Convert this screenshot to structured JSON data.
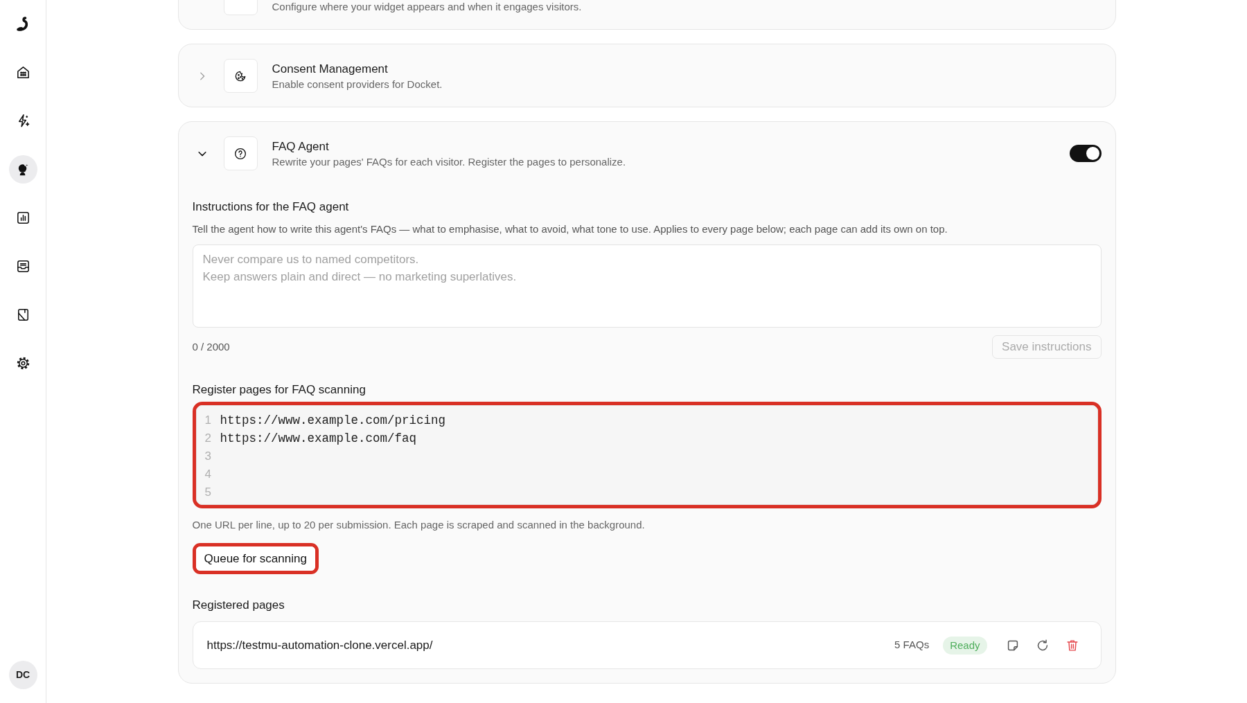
{
  "sidebar": {
    "items": [
      {
        "selected": false
      },
      {
        "selected": false
      },
      {
        "selected": true
      },
      {
        "selected": false
      },
      {
        "selected": false
      },
      {
        "selected": false
      },
      {
        "selected": false
      }
    ],
    "avatar": "DC"
  },
  "sections": [
    {
      "description": "Configure where your widget appears and when it engages visitors."
    },
    {
      "title": "Consent Management",
      "description": "Enable consent providers for Docket.",
      "expanded": false
    },
    {
      "title": "FAQ Agent",
      "description": "Rewrite your pages' FAQs for each visitor. Register the pages to personalize.",
      "expanded": true,
      "enabled": true,
      "instructions": {
        "heading": "Instructions for the FAQ agent",
        "hint": "Tell the agent how to write this agent's FAQs — what to emphasise, what to avoid, what tone to use. Applies to every page below; each page can add its own on top.",
        "placeholder": "Never compare us to named competitors.\nKeep answers plain and direct — no marketing superlatives.",
        "counter": "0 / 2000",
        "save_button": {
          "label": "Save instructions",
          "disabled": true
        }
      },
      "register": {
        "heading": "Register pages for FAQ scanning",
        "highlighted": true,
        "lines": [
          {
            "number": "1",
            "text": "https://www.example.com/pricing"
          },
          {
            "number": "2",
            "text": "https://www.example.com/faq"
          },
          {
            "number": "3"
          },
          {
            "number": "4"
          },
          {
            "number": "5"
          }
        ],
        "hint": "One URL per line, up to 20 per submission. Each page is scraped and scanned in the background.",
        "queue_button": {
          "label": "Queue for scanning",
          "highlighted": true
        }
      },
      "registered": {
        "heading": "Registered pages",
        "pages": [
          {
            "url": "https://testmu-automation-clone.vercel.app/",
            "count": "5 FAQs",
            "status": "Ready",
            "color": "#4fae5c"
          }
        ]
      }
    }
  ]
}
